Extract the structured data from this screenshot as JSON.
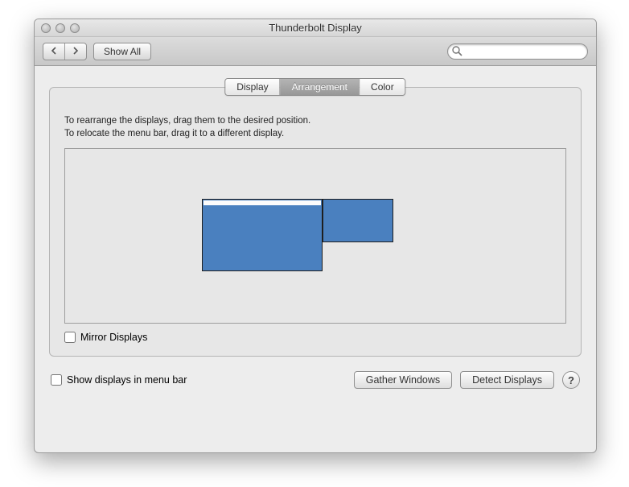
{
  "window": {
    "title": "Thunderbolt Display"
  },
  "toolbar": {
    "show_all": "Show All",
    "search_placeholder": ""
  },
  "tabs": {
    "display": "Display",
    "arrangement": "Arrangement",
    "color": "Color",
    "selected_index": 1
  },
  "arrangement": {
    "instruction_line1": "To rearrange the displays, drag them to the desired position.",
    "instruction_line2": "To relocate the menu bar, drag it to a different display.",
    "mirror_checkbox_label": "Mirror Displays",
    "mirror_checked": false,
    "displays": [
      {
        "is_primary": true,
        "has_menu_bar": true
      },
      {
        "is_primary": false,
        "has_menu_bar": false
      }
    ]
  },
  "footer": {
    "show_in_menu_bar_label": "Show displays in menu bar",
    "show_in_menu_bar_checked": false,
    "gather_windows": "Gather Windows",
    "detect_displays": "Detect Displays",
    "help_label": "?"
  }
}
